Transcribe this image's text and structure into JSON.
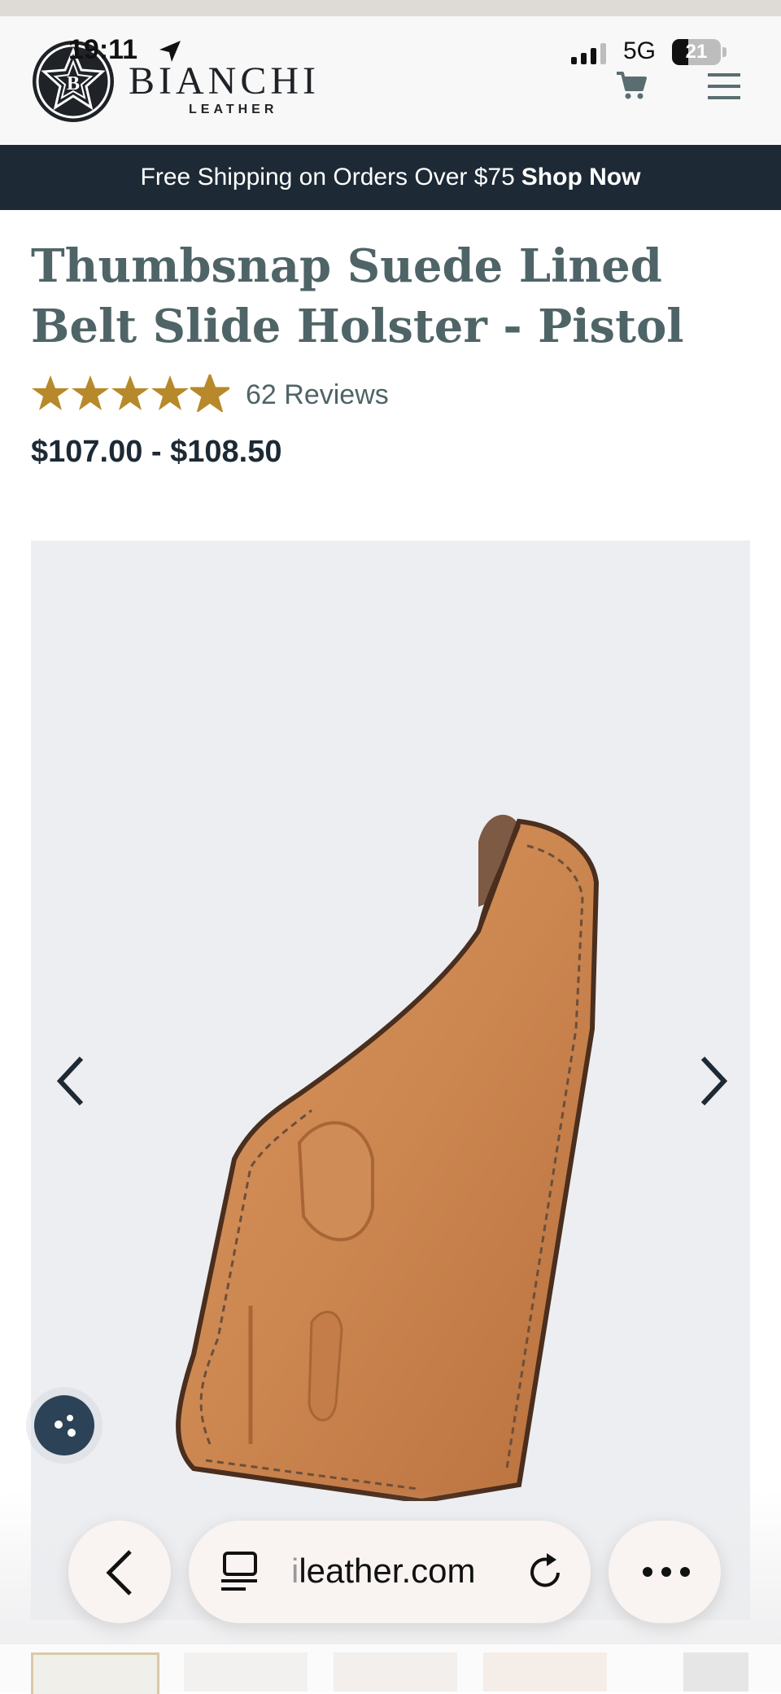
{
  "status_bar": {
    "time": "19:11",
    "network": "5G",
    "battery": "21"
  },
  "header": {
    "brand": "BIANCHI",
    "brand_sub": "LEATHER"
  },
  "promo": {
    "text": "Free Shipping on Orders Over $75",
    "link": "Shop Now"
  },
  "product": {
    "title_line1": "Thumbsnap Suede Lined",
    "title_line2": "Belt Slide Holster - Pistol",
    "rating": 4.5,
    "reviews": "62 Reviews",
    "price": "$107.00 - $108.50"
  },
  "browser": {
    "url_faint": "i",
    "url": "leather.com"
  },
  "colors": {
    "accent": "#b8892a",
    "navy": "#1d2a35",
    "title": "#4f6466",
    "leather": "#c98550"
  }
}
